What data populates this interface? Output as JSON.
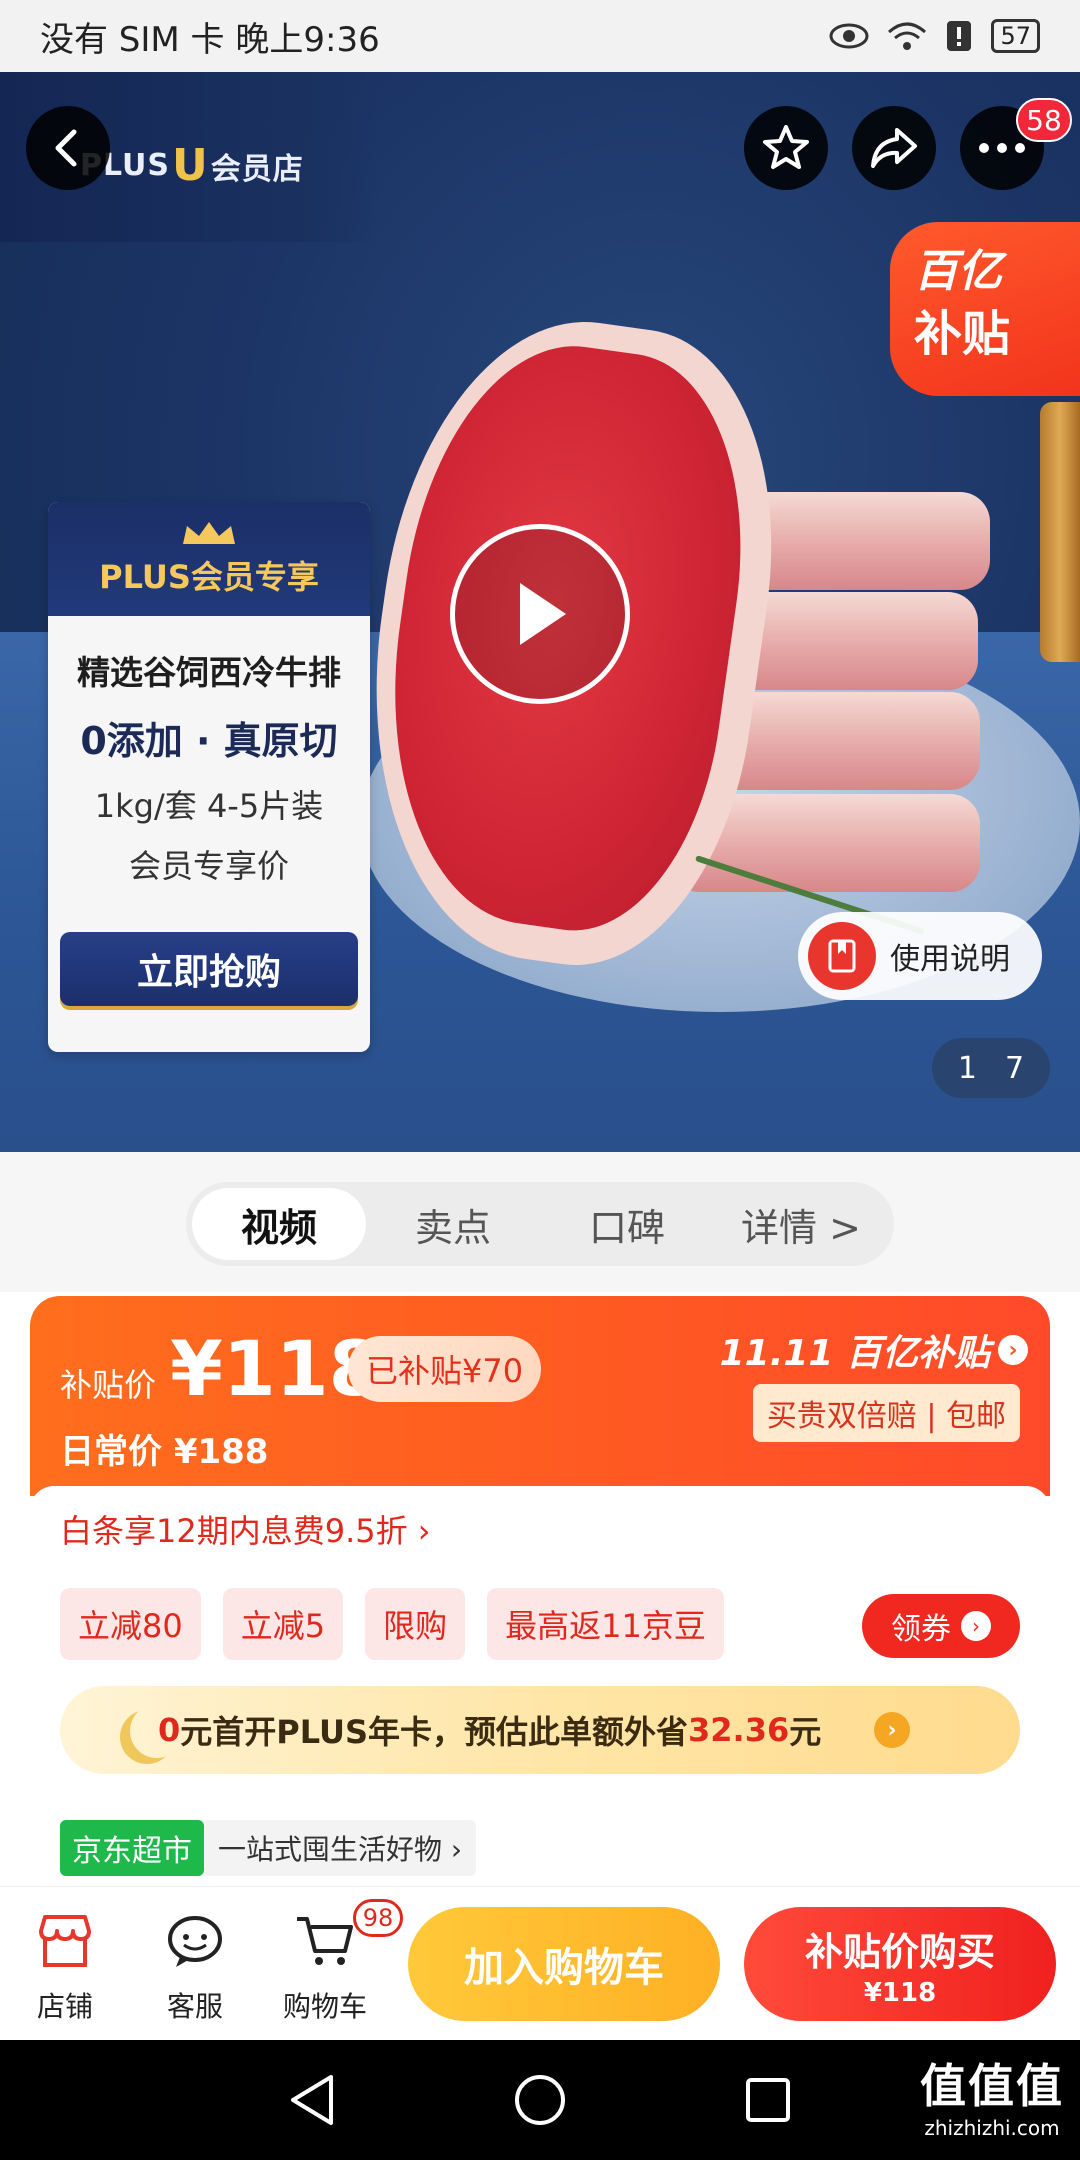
{
  "status_bar": {
    "carrier_time": "没有 SIM 卡 晚上9:36",
    "battery": "57"
  },
  "hero": {
    "logo_text_left": "PLUS",
    "logo_text_u": "U",
    "logo_text_right": "会员店",
    "more_badge": "58",
    "subsidy_line1": "百亿",
    "subsidy_line2": "补贴",
    "promo": {
      "header": "PLUS会员专享",
      "title": "精选谷饲西冷牛排",
      "subtitle": "0添加 · 真原切",
      "spec": "1kg/套 4-5片装",
      "price_note": "会员专享价",
      "button": "立即抢购"
    },
    "guide_label": "使用说明",
    "page_current": "1",
    "page_total": "7"
  },
  "tabs": [
    "视频",
    "卖点",
    "口碑",
    "详情 >"
  ],
  "price": {
    "label": "补贴价",
    "value": "¥118",
    "subsidized": "已补贴¥70",
    "regular": "日常价 ¥188",
    "event": "11.11 百亿补贴",
    "guarantee": "买贵双倍赔 | 包邮"
  },
  "offers": {
    "baitiao": "白条享12期内息费9.5折 ›",
    "coupons": [
      "立减80",
      "立减5",
      "限购",
      "最高返11京豆"
    ],
    "claim_button": "领券",
    "plus_prefix": "0",
    "plus_mid": "元首开PLUS年卡，预估此单额外省",
    "plus_amount": "32.36",
    "plus_suffix": "元",
    "chaoshi_tag": "京东超市",
    "chaoshi_text": "一站式囤生活好物 ›"
  },
  "bottom_bar": {
    "store": "店铺",
    "service": "客服",
    "cart": "购物车",
    "cart_count": "98",
    "add_cart": "加入购物车",
    "buy_line1": "补贴价购买",
    "buy_line2": "¥118"
  },
  "watermark": {
    "line1": "值值值",
    "line2": "zhizhizhi.com"
  },
  "colors": {
    "accent_orange": "#ff5a22",
    "accent_red": "#f0201f",
    "plus_navy": "#1b2f68"
  }
}
